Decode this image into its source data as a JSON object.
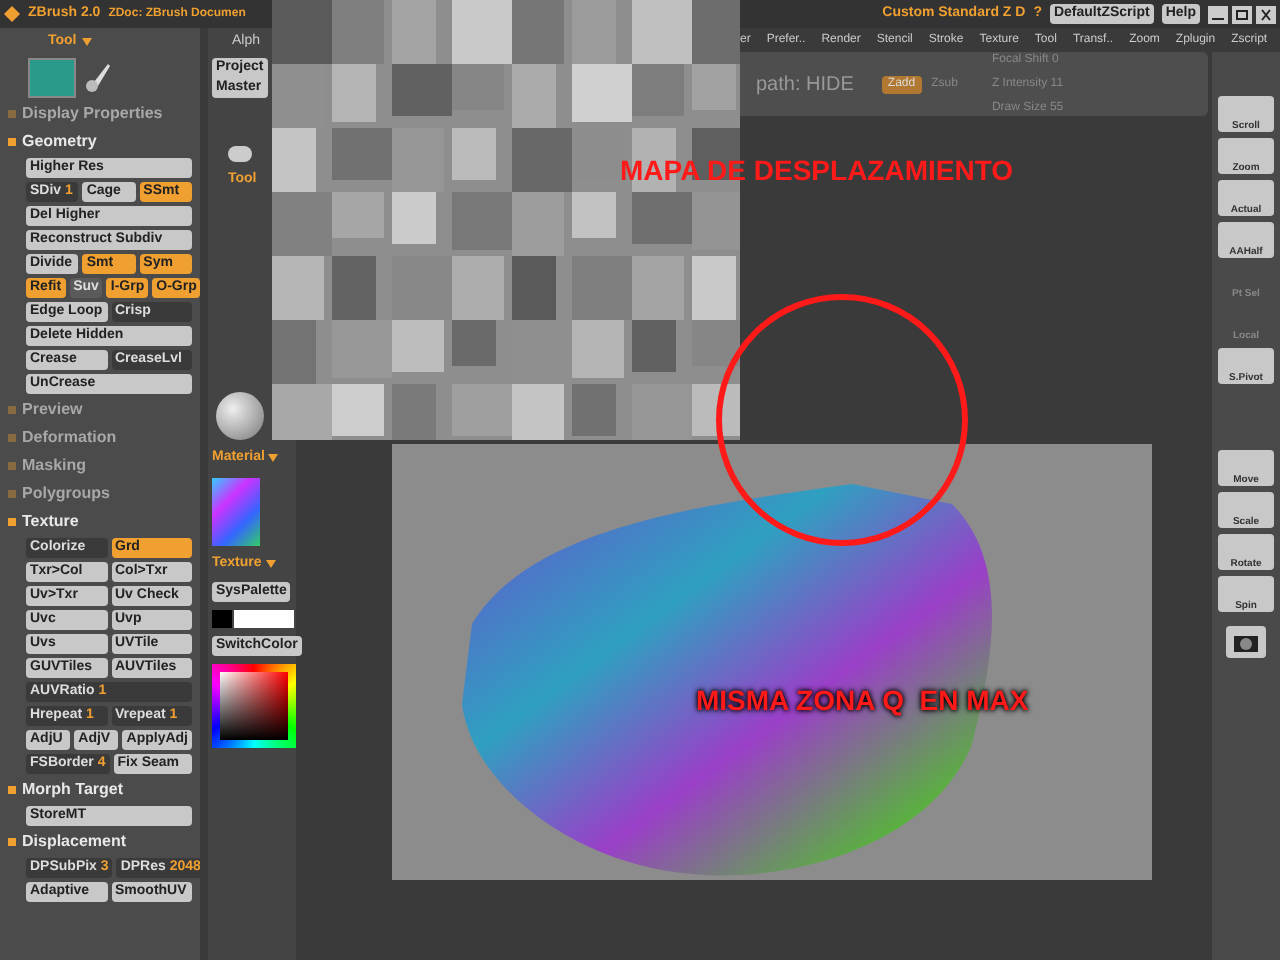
{
  "title_bar": {
    "app": "ZBrush 2.0",
    "document": "ZDoc: ZBrush Documen",
    "layout": "Custom Standard Z D",
    "help_mark": "?",
    "buttons": [
      "DefaultZScript",
      "Help"
    ]
  },
  "menu": [
    "er",
    "Prefer..",
    "Render",
    "Stencil",
    "Stroke",
    "Texture",
    "Tool",
    "Transf..",
    "Zoom",
    "Zplugin",
    "Zscript"
  ],
  "toolbar": {
    "path": "path: HIDE",
    "items": [
      {
        "label": "Zadd",
        "on": true
      },
      {
        "label": "Zsub",
        "on": false
      }
    ],
    "focal_shift": "Focal Shift 0",
    "z_intensity": "Z Intensity 11",
    "draw_size": "Draw Size 55"
  },
  "tool_panel": {
    "header": "Tool",
    "sections": [
      {
        "title": "Display Properties",
        "expanded": false
      },
      {
        "title": "Geometry",
        "expanded": true,
        "rows": [
          [
            {
              "kind": "button",
              "label": "Higher Res"
            }
          ],
          [
            {
              "kind": "slider",
              "label": "SDiv",
              "value": "1"
            },
            {
              "kind": "button",
              "label": "Cage"
            },
            {
              "kind": "toggle",
              "label": "SSmt",
              "on": true
            }
          ],
          [
            {
              "kind": "button",
              "label": "Del Higher"
            }
          ],
          [
            {
              "kind": "button",
              "label": "Reconstruct Subdiv"
            }
          ],
          [
            {
              "kind": "button",
              "label": "Divide"
            },
            {
              "kind": "toggle",
              "label": "Smt",
              "on": true
            },
            {
              "kind": "toggle",
              "label": "Sym",
              "on": true
            }
          ],
          [
            {
              "kind": "toggle",
              "label": "Refit",
              "on": true
            },
            {
              "kind": "toggle",
              "label": "Suv",
              "on": false
            },
            {
              "kind": "toggle",
              "label": "I-Grp",
              "on": true
            },
            {
              "kind": "toggle",
              "label": "O-Grp",
              "on": true
            }
          ],
          [
            {
              "kind": "button",
              "label": "Edge Loop"
            },
            {
              "kind": "slider",
              "label": "Crisp"
            }
          ],
          [
            {
              "kind": "button",
              "label": "Delete Hidden"
            }
          ],
          [
            {
              "kind": "button",
              "label": "Crease"
            },
            {
              "kind": "slider",
              "label": "CreaseLvl"
            }
          ],
          [
            {
              "kind": "button",
              "label": "UnCrease"
            }
          ]
        ]
      },
      {
        "title": "Preview",
        "expanded": false
      },
      {
        "title": "Deformation",
        "expanded": false
      },
      {
        "title": "Masking",
        "expanded": false
      },
      {
        "title": "Polygroups",
        "expanded": false
      },
      {
        "title": "Texture",
        "expanded": true,
        "rows": [
          [
            {
              "kind": "slider",
              "label": "Colorize"
            },
            {
              "kind": "toggle",
              "label": "Grd",
              "on": true
            }
          ],
          [
            {
              "kind": "button",
              "label": "Txr>Col"
            },
            {
              "kind": "button",
              "label": "Col>Txr"
            }
          ],
          [
            {
              "kind": "button",
              "label": "Uv>Txr"
            },
            {
              "kind": "button",
              "label": "Uv Check"
            }
          ],
          [
            {
              "kind": "button",
              "label": "Uvc"
            },
            {
              "kind": "button",
              "label": "Uvp"
            }
          ],
          [
            {
              "kind": "button",
              "label": "Uvs"
            },
            {
              "kind": "button",
              "label": "UVTile"
            }
          ],
          [
            {
              "kind": "button",
              "label": "GUVTiles"
            },
            {
              "kind": "button",
              "label": "AUVTiles"
            }
          ],
          [
            {
              "kind": "slider",
              "label": "AUVRatio",
              "value": "1"
            }
          ],
          [
            {
              "kind": "slider",
              "label": "Hrepeat",
              "value": "1"
            },
            {
              "kind": "slider",
              "label": "Vrepeat",
              "value": "1"
            }
          ],
          [
            {
              "kind": "button",
              "label": "AdjU"
            },
            {
              "kind": "button",
              "label": "AdjV"
            },
            {
              "kind": "button",
              "label": "ApplyAdj"
            }
          ],
          [
            {
              "kind": "slider",
              "label": "FSBorder",
              "value": "4"
            },
            {
              "kind": "button",
              "label": "Fix Seam"
            }
          ]
        ]
      },
      {
        "title": "Morph Target",
        "expanded": true,
        "rows": [
          [
            {
              "kind": "button",
              "label": "StoreMT"
            }
          ]
        ]
      },
      {
        "title": "Displacement",
        "expanded": true,
        "rows": [
          [
            {
              "kind": "slider",
              "label": "DPSubPix",
              "value": "3"
            },
            {
              "kind": "slider",
              "label": "DPRes",
              "value": "2048"
            }
          ],
          [
            {
              "kind": "button",
              "label": "Adaptive"
            },
            {
              "kind": "button",
              "label": "SmoothUV"
            }
          ]
        ]
      }
    ]
  },
  "palette": {
    "alpha_tab": "Alph",
    "projection": [
      "Project",
      "Master"
    ],
    "tool_label": "Tool",
    "material_label": "Material",
    "texture_label": "Texture",
    "sys_palette": "SysPalette",
    "switch_color": "SwitchColor"
  },
  "annotations": [
    "MAPA DE DESPLAZAMIENTO",
    "MISMA ZONA Q  EN MAX"
  ],
  "right_toolbar": [
    {
      "label": "Scroll",
      "disabled": false
    },
    {
      "label": "Zoom",
      "disabled": false
    },
    {
      "label": "Actual",
      "disabled": false
    },
    {
      "label": "AAHalf",
      "disabled": false
    },
    {
      "label": "Pt Sel",
      "disabled": true
    },
    {
      "label": "Local",
      "disabled": true
    },
    {
      "label": "S.Pivot",
      "disabled": false
    },
    {
      "label": "Move",
      "disabled": false
    },
    {
      "label": "Scale",
      "disabled": false
    },
    {
      "label": "Rotate",
      "disabled": false
    },
    {
      "label": "Spin",
      "disabled": false
    }
  ]
}
